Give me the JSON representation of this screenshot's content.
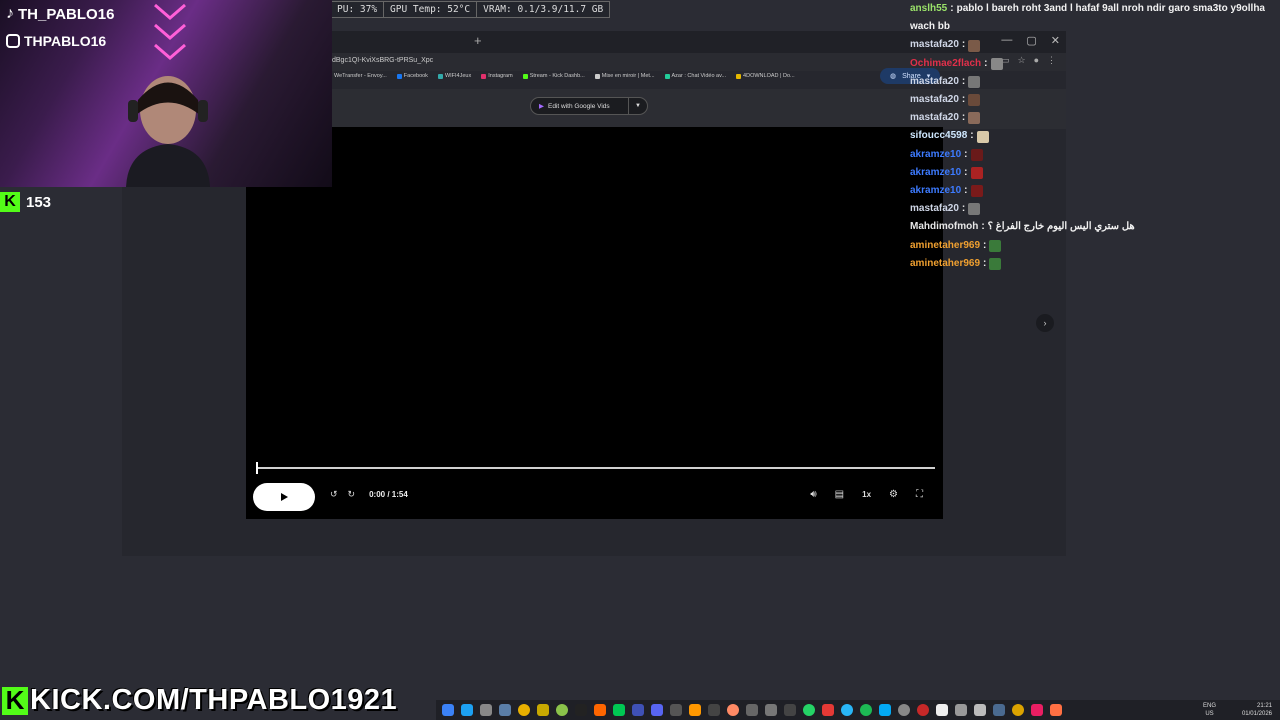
{
  "stats": {
    "cpu": "PU: 37%",
    "gpu_temp": "GPU Temp: 52°C",
    "vram": "VRAM: 0.1/3.9/11.7 GB"
  },
  "browser": {
    "url": "dBgc1QI-KviXsBRG-tPRSu_Xpc",
    "bookmarks": [
      "WeTransfer - Envoy...",
      "Facebook",
      "WIFI4Jeux",
      "Instagram",
      "Stream - Kick Dashb...",
      "Mise en miroir | Met...",
      "Azar : Chat Vidéo av...",
      "4DOWNLOAD | Do..."
    ],
    "edit_button": "Edit with Google Vids",
    "share_button": "Share"
  },
  "video": {
    "time": "0:00 / 1:54",
    "speed": "1x",
    "progress": 0
  },
  "stream": {
    "tiktok": "TH_PABLO16",
    "instagram": "THPABLO16",
    "viewers": "153",
    "banner": "KICK.COM/THPABLO1921"
  },
  "chat": [
    {
      "user": "anslh55",
      "color": "#9be36a",
      "msg": "pablo l bareh roht 3and l hafaf 9all nroh ndir garo sma3to y9ollha",
      "emote": ""
    },
    {
      "user": "",
      "color": "#ffffff",
      "msg": "wach bb",
      "emote": ""
    },
    {
      "user": "mastafa20",
      "color": "#cfd6e6",
      "msg": "",
      "emote": "#7a5a48"
    },
    {
      "user": "Ochimae2flach",
      "color": "#e0304a",
      "msg": "",
      "emote": "#888"
    },
    {
      "user": "mastafa20",
      "color": "#cfd6e6",
      "msg": "",
      "emote": "#777"
    },
    {
      "user": "mastafa20",
      "color": "#cfd6e6",
      "msg": "",
      "emote": "#6a4a3a"
    },
    {
      "user": "mastafa20",
      "color": "#cfd6e6",
      "msg": "",
      "emote": "#8a6a5a"
    },
    {
      "user": "sifoucc4598",
      "color": "#cfe8ff",
      "msg": "",
      "emote": "#d9c9a9"
    },
    {
      "user": "akramze10",
      "color": "#3d7bff",
      "msg": "",
      "emote": "#6a1a1a"
    },
    {
      "user": "akramze10",
      "color": "#3d7bff",
      "msg": "",
      "emote": "#aa2222"
    },
    {
      "user": "akramze10",
      "color": "#3d7bff",
      "msg": "",
      "emote": "#7a1a1a"
    },
    {
      "user": "mastafa20",
      "color": "#cfd6e6",
      "msg": "",
      "emote": "#777"
    },
    {
      "user": "Mahdimofmoh",
      "color": "#e6e6e6",
      "msg": "هل ستري اليس اليوم خارج الفراغ ؟",
      "emote": ""
    },
    {
      "user": "aminetaher969",
      "color": "#f0a030",
      "msg": "",
      "emote": "#3a7a3a"
    },
    {
      "user": "aminetaher969",
      "color": "#f0a030",
      "msg": "",
      "emote": "#3a7a3a"
    }
  ],
  "taskbar": {
    "lang_top": "ENG",
    "lang_bottom": "US",
    "time": "21:21",
    "date": "01/01/2026"
  },
  "colors": {
    "kick_green": "#53fc18",
    "accent_blue": "#1e3a66"
  }
}
